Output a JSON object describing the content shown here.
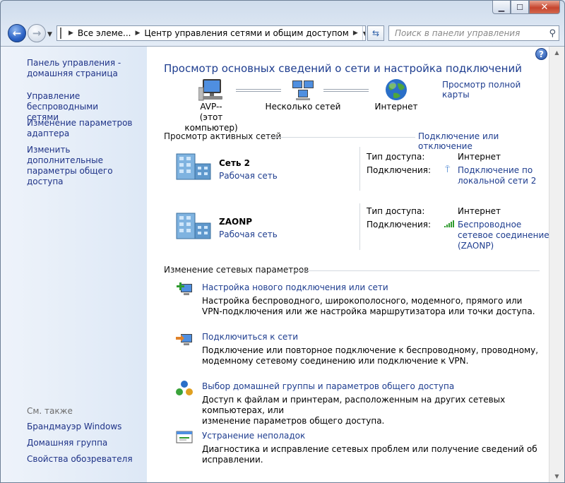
{
  "address": {
    "crumbs": [
      "Все элеме...",
      "Центр управления сетями и общим доступом"
    ]
  },
  "search": {
    "placeholder": "Поиск в панели управления"
  },
  "sidebar": {
    "links": [
      {
        "text": "Панель управления -\nдомашняя страница"
      },
      {
        "text": "Управление беспроводными\nсетями"
      },
      {
        "text": "Изменение параметров\nадаптера"
      },
      {
        "text": "Изменить дополнительные\nпараметры общего доступа"
      }
    ],
    "see_also_title": "См. также",
    "see_also": [
      "Брандмауэр Windows",
      "Домашняя группа",
      "Свойства обозревателя"
    ]
  },
  "main": {
    "title": "Просмотр основных сведений о сети и настройка подключений",
    "full_map_link": "Просмотр полной карты",
    "map": {
      "computer": "AVP--",
      "computer_sub": "(этот компьютер)",
      "networks": "Несколько сетей",
      "internet": "Интернет"
    },
    "active_header": "Просмотр активных сетей",
    "connect_link": "Подключение или отключение",
    "networks": [
      {
        "name": "Сеть  2",
        "category": "Рабочая сеть",
        "access_label": "Тип доступа:",
        "access_value": "Интернет",
        "conn_label": "Подключения:",
        "conn_value": "Подключение по\nлокальной сети 2"
      },
      {
        "name": "ZAONP",
        "category": "Рабочая сеть",
        "access_label": "Тип доступа:",
        "access_value": "Интернет",
        "conn_label": "Подключения:",
        "conn_value": "Беспроводное\nсетевое соединение\n(ZAONP)"
      }
    ],
    "change_header": "Изменение сетевых параметров",
    "tasks": [
      {
        "link": "Настройка нового подключения или сети",
        "desc": "Настройка беспроводного, широкополосного, модемного, прямого или\nVPN-подключения или же настройка маршрутизатора или точки доступа."
      },
      {
        "link": "Подключиться к сети",
        "desc": "Подключение или повторное подключение к беспроводному, проводному,\nмодемному сетевому соединению или подключение к VPN."
      },
      {
        "link": "Выбор домашней группы и параметров общего доступа",
        "desc": "Доступ к файлам и принтерам, расположенным на других сетевых компьютерах, или\nизменение параметров общего доступа."
      },
      {
        "link": "Устранение неполадок",
        "desc": "Диагностика и исправление сетевых проблем или получение сведений об\nисправлении."
      }
    ]
  }
}
